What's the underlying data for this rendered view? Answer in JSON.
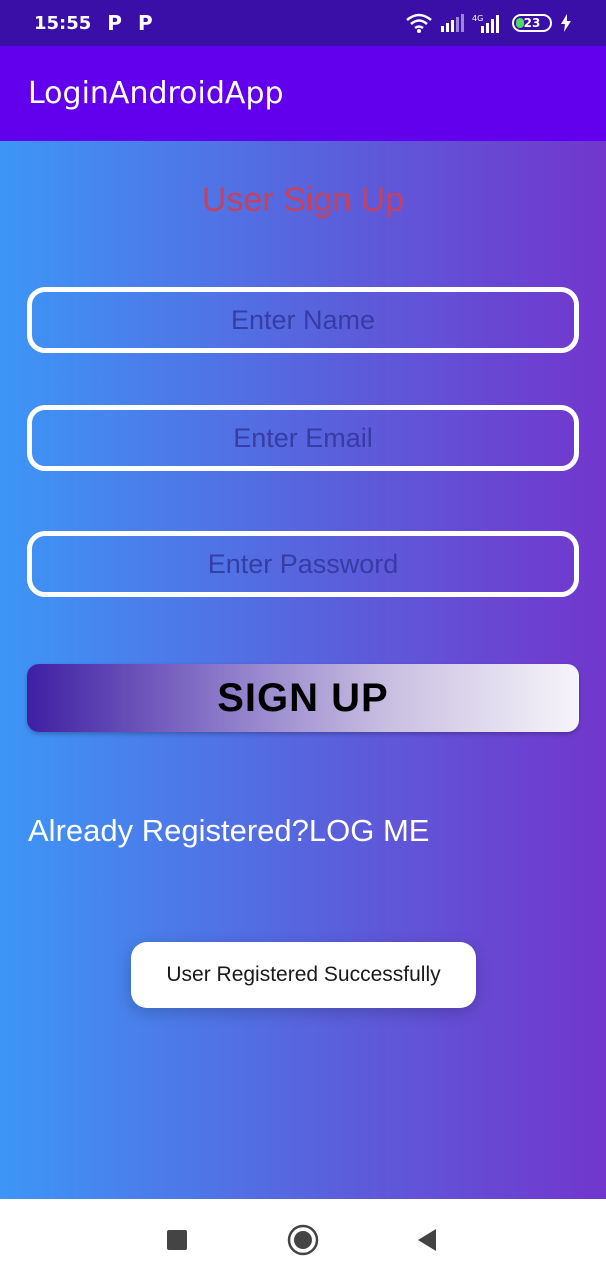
{
  "status_bar": {
    "time": "15:55",
    "notification_icons": [
      "P",
      "P"
    ],
    "network_label": "4G",
    "battery_level": "23"
  },
  "app_bar": {
    "title": "LoginAndroidApp",
    "color": "#6200ee"
  },
  "form": {
    "title": "User Sign Up",
    "name_placeholder": "Enter Name",
    "email_placeholder": "Enter Email",
    "password_placeholder": "Enter Password",
    "signup_label": "SIGN UP",
    "login_link": "Already Registered?LOG ME"
  },
  "toast": {
    "message": "User Registered Successfully"
  },
  "nav_bar": {
    "icons": [
      "recents-square-icon",
      "home-circle-icon",
      "back-triangle-icon"
    ]
  },
  "colors": {
    "gradient_start": "#3d96f6",
    "gradient_end": "#7236cc",
    "title_color": "#c8405a"
  }
}
